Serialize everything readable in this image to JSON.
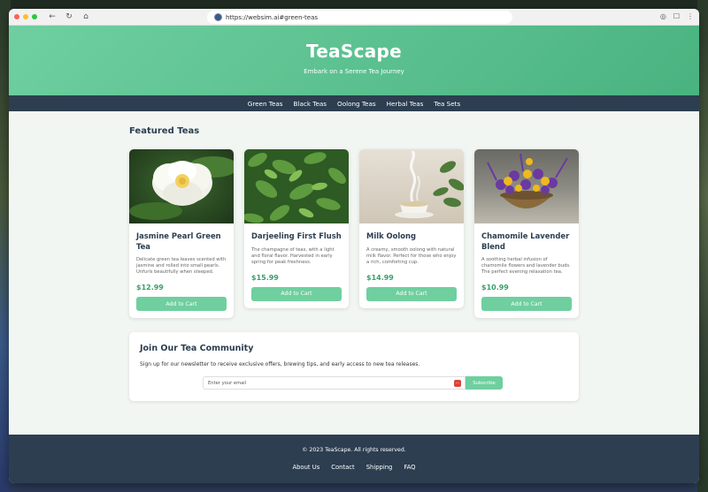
{
  "browser": {
    "url": "https://websim.ai#green-teas",
    "traffic_lights": [
      "#ff5f57",
      "#febc2e",
      "#28c840"
    ]
  },
  "hero": {
    "title": "TeaScape",
    "subtitle": "Embark on a Serene Tea Journey",
    "gradient": [
      "#6fcfa0",
      "#49b380"
    ]
  },
  "nav": {
    "items": [
      "Green Teas",
      "Black Teas",
      "Oolong Teas",
      "Herbal Teas",
      "Tea Sets"
    ]
  },
  "featured": {
    "title": "Featured Teas",
    "products": [
      {
        "name": "Jasmine Pearl Green Tea",
        "description": "Delicate green tea leaves scented with jasmine and rolled into small pearls. Unfurls beautifully when steeped.",
        "price": "$12.99",
        "button": "Add to Cart",
        "image": "white-jasmine-flower"
      },
      {
        "name": "Darjeeling First Flush",
        "description": "The champagne of teas, with a light and floral flavor. Harvested in early spring for peak freshness.",
        "price": "$15.99",
        "button": "Add to Cart",
        "image": "green-tea-leaves"
      },
      {
        "name": "Milk Oolong",
        "description": "A creamy, smooth oolong with natural milk flavor. Perfect for those who enjoy a rich, comforting cup.",
        "price": "$14.99",
        "button": "Add to Cart",
        "image": "steaming-teacup"
      },
      {
        "name": "Chamomile Lavender Blend",
        "description": "A soothing herbal infusion of chamomile flowers and lavender buds. The perfect evening relaxation tea.",
        "price": "$10.99",
        "button": "Add to Cart",
        "image": "flower-bowl"
      }
    ]
  },
  "newsletter": {
    "title": "Join Our Tea Community",
    "text": "Sign up for our newsletter to receive exclusive offers, brewing tips, and early access to new tea releases.",
    "placeholder": "Enter your email",
    "button": "Subscribe"
  },
  "footer": {
    "copyright": "© 2023 TeaScape. All rights reserved.",
    "links": [
      "About Us",
      "Contact",
      "Shipping",
      "FAQ"
    ]
  },
  "colors": {
    "accent": "#6fcf9f",
    "price": "#3a9e6a",
    "dark": "#2c3e50"
  }
}
